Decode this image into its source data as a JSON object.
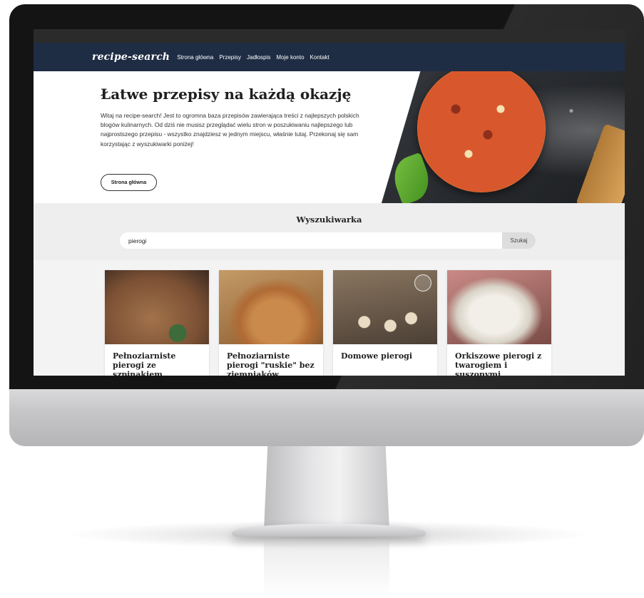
{
  "nav": {
    "brand": "recipe-search",
    "links": [
      "Strona główna",
      "Przepisy",
      "Jadłospis",
      "Moje konto",
      "Kontakt"
    ]
  },
  "hero": {
    "title": "Łatwe przepisy na każdą okazję",
    "text": "Witaj na recipe-search! Jest to ogromna baza przepisów zawierająca treści z najlepszych polskich blogów kulinarnych. Od dziś nie musisz przeglądać wielu stron w poszukiwaniu najlepszego lub najprostszego przepisu - wszystko znajdziesz w jednym miejscu, właśnie tutaj. Przekonaj się sam korzystając z wyszukiwarki poniżej!",
    "button": "Strona główna"
  },
  "search": {
    "title": "Wyszukiwarka",
    "value": "pierogi",
    "button": "Szukaj"
  },
  "results": [
    {
      "title": "Pełnoziarniste pierogi ze szpinakiem"
    },
    {
      "title": "Pełnoziarniste pierogi \"ruskie\" bez ziemniaków"
    },
    {
      "title": "Domowe pierogi"
    },
    {
      "title": "Orkiszowe pierogi z twarogiem i suszonymi"
    }
  ],
  "colors": {
    "navbar": "#1f2d44",
    "search_band": "#eeeeee",
    "monitor_bezel": "#141414",
    "monitor_chin": "#c6c6c8"
  }
}
